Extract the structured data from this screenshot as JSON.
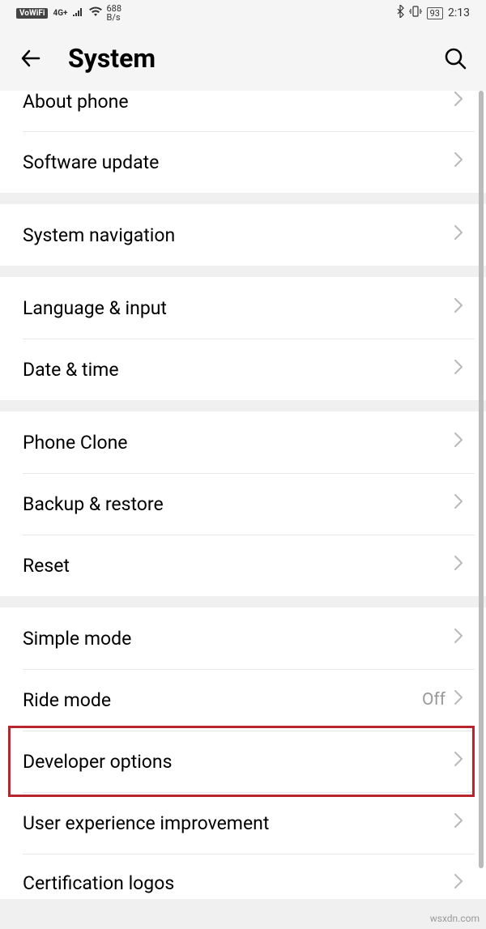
{
  "statusBar": {
    "vowifi": "VoWiFi",
    "network": "4G+",
    "speed": "688",
    "speedUnit": "B/s",
    "battery": "93",
    "time": "2:13"
  },
  "header": {
    "title": "System"
  },
  "sections": [
    {
      "rows": [
        {
          "label": "About phone",
          "value": "",
          "short": true
        },
        {
          "label": "Software update",
          "value": ""
        }
      ]
    },
    {
      "rows": [
        {
          "label": "System navigation",
          "value": ""
        }
      ]
    },
    {
      "rows": [
        {
          "label": "Language & input",
          "value": ""
        },
        {
          "label": "Date & time",
          "value": ""
        }
      ]
    },
    {
      "rows": [
        {
          "label": "Phone Clone",
          "value": ""
        },
        {
          "label": "Backup & restore",
          "value": ""
        },
        {
          "label": "Reset",
          "value": ""
        }
      ]
    },
    {
      "rows": [
        {
          "label": "Simple mode",
          "value": ""
        },
        {
          "label": "Ride mode",
          "value": "Off"
        },
        {
          "label": "Developer options",
          "value": "",
          "highlight": true
        },
        {
          "label": "User experience improvement",
          "value": ""
        },
        {
          "label": "Certification logos",
          "value": "",
          "short_bottom": true
        }
      ]
    }
  ],
  "watermark": "wsxdn.com"
}
